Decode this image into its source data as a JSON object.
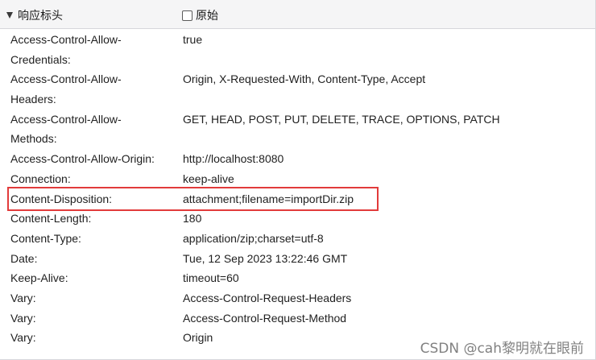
{
  "section": {
    "title": "响应标头",
    "raw_label": "原始"
  },
  "headers": [
    {
      "name": "Access-Control-Allow-\nCredentials:",
      "value": "true"
    },
    {
      "name": "Access-Control-Allow-\nHeaders:",
      "value": "Origin, X-Requested-With, Content-Type, Accept"
    },
    {
      "name": "Access-Control-Allow-\nMethods:",
      "value": "GET, HEAD, POST, PUT, DELETE, TRACE, OPTIONS, PATCH"
    },
    {
      "name": "Access-Control-Allow-Origin:",
      "value": "http://localhost:8080"
    },
    {
      "name": "Connection:",
      "value": "keep-alive"
    },
    {
      "name": "Content-Disposition:",
      "value": "attachment;filename=importDir.zip"
    },
    {
      "name": "Content-Length:",
      "value": "180"
    },
    {
      "name": "Content-Type:",
      "value": "application/zip;charset=utf-8"
    },
    {
      "name": "Date:",
      "value": "Tue, 12 Sep 2023 13:22:46 GMT"
    },
    {
      "name": "Keep-Alive:",
      "value": "timeout=60"
    },
    {
      "name": "Vary:",
      "value": "Access-Control-Request-Headers"
    },
    {
      "name": "Vary:",
      "value": "Access-Control-Request-Method"
    },
    {
      "name": "Vary:",
      "value": "Origin"
    }
  ],
  "highlight_color": "#e23b3b",
  "watermark": "CSDN @cah黎明就在眼前"
}
